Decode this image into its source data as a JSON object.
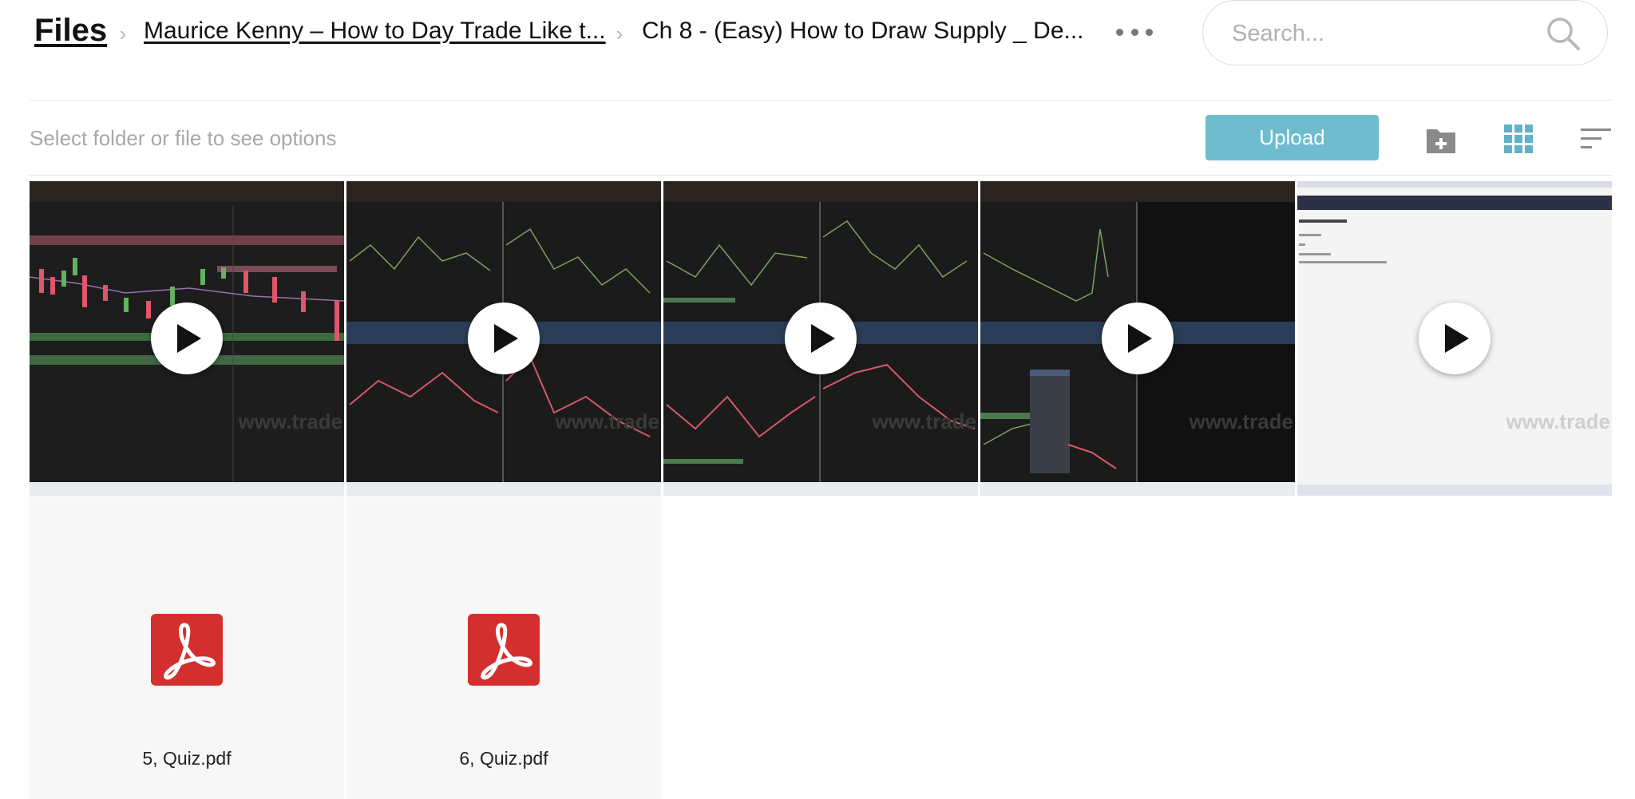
{
  "breadcrumb": {
    "root": "Files",
    "folder": "Maurice Kenny – How to Day Trade Like t...",
    "current": "Ch 8 - (Easy) How to Draw Supply _ De..."
  },
  "search": {
    "placeholder": "Search..."
  },
  "toolbar": {
    "hint": "Select folder or file to see options",
    "upload_label": "Upload"
  },
  "files": [
    {
      "type": "video",
      "thumb": "chart-single-window",
      "watermark": "www.trade"
    },
    {
      "type": "video",
      "thumb": "chart-quad-window",
      "watermark": "www.trade"
    },
    {
      "type": "video",
      "thumb": "chart-quad-window",
      "watermark": "www.trade"
    },
    {
      "type": "video",
      "thumb": "chart-quad-menu",
      "watermark": "www.trade"
    },
    {
      "type": "video",
      "thumb": "document-page",
      "watermark": "www.trade"
    },
    {
      "type": "pdf",
      "name": "5, Quiz.pdf"
    },
    {
      "type": "pdf",
      "name": "6, Quiz.pdf"
    }
  ],
  "colors": {
    "accent": "#6fbccf",
    "pdf": "#d32f2f",
    "icons": "#8a8a8a"
  }
}
